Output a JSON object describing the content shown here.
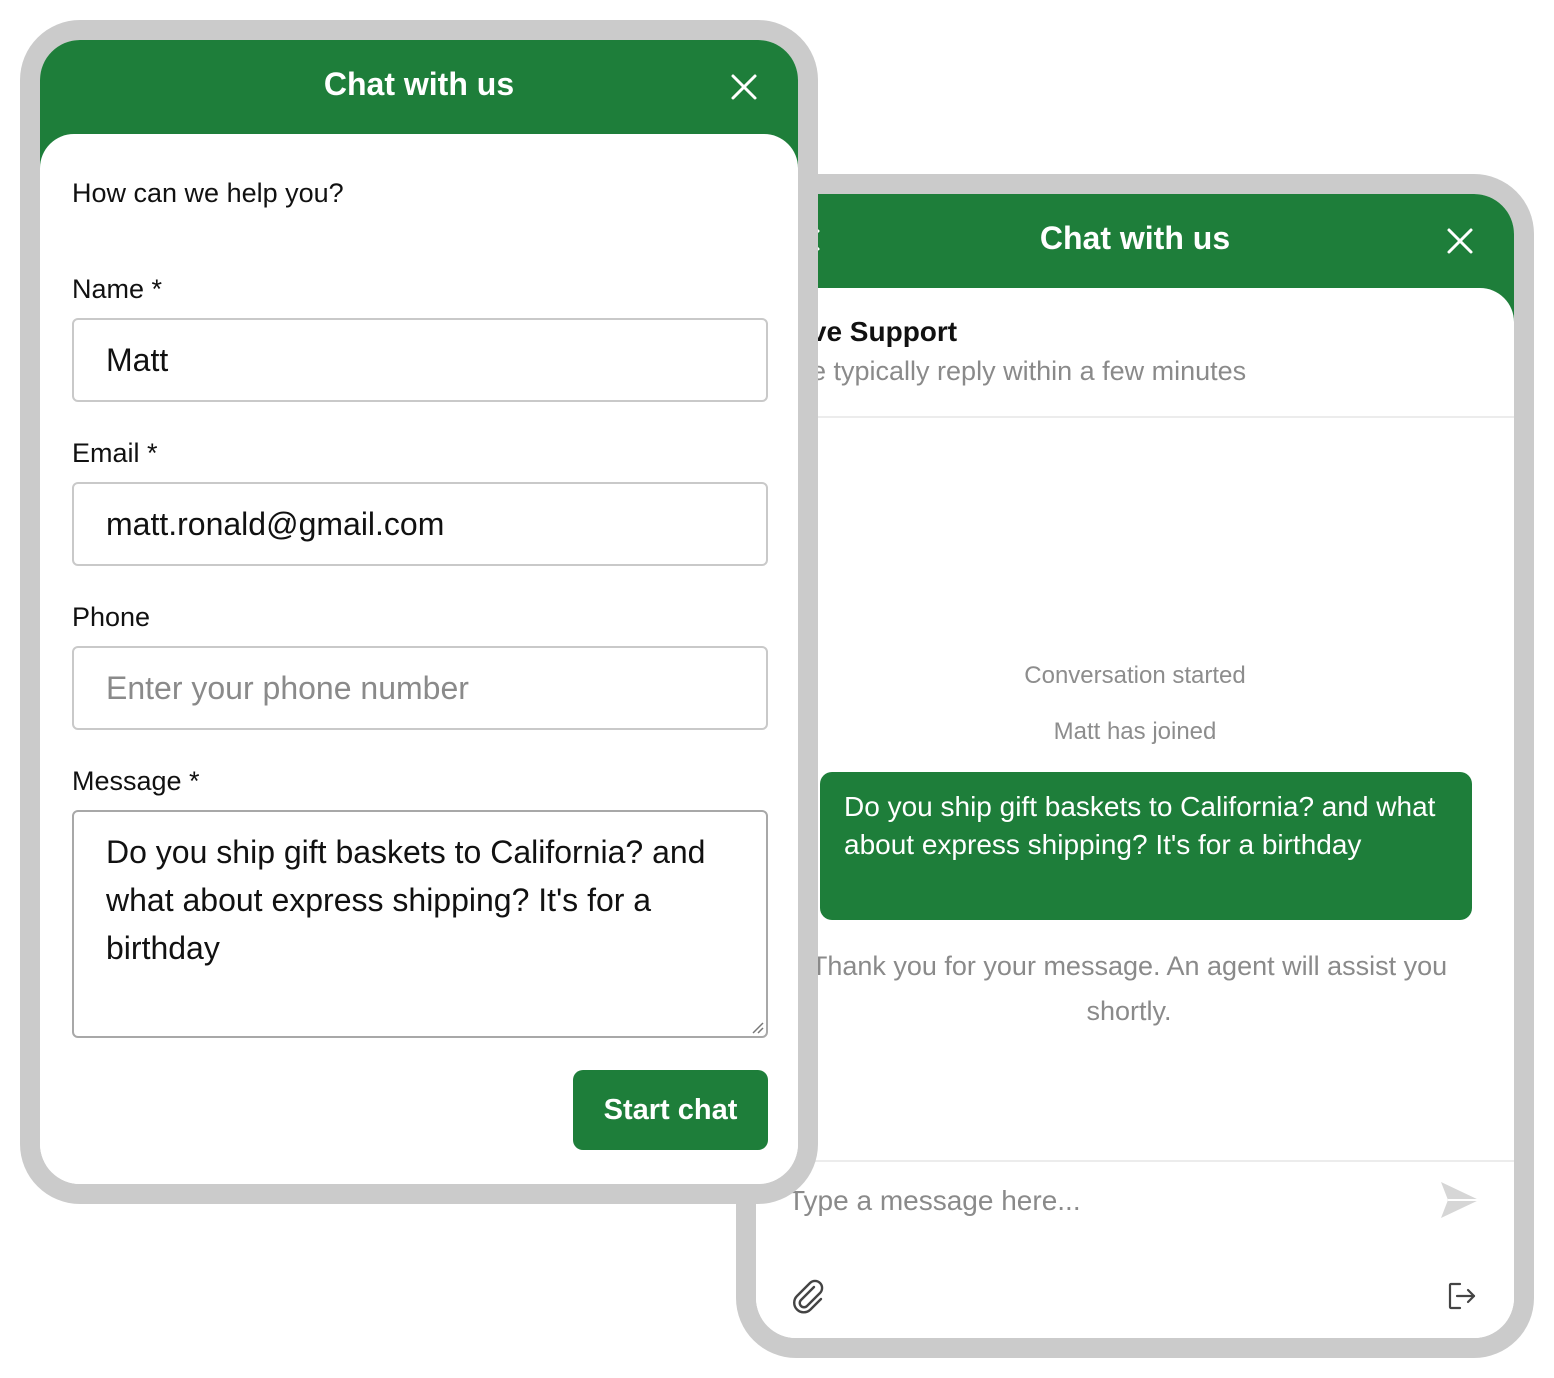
{
  "chat_form": {
    "title": "Chat with us",
    "intro": "How can we help you?",
    "name": {
      "label": "Name *",
      "value": "Matt"
    },
    "email": {
      "label": "Email *",
      "value": "matt.ronald@gmail.com"
    },
    "phone": {
      "label": "Phone",
      "value": "",
      "placeholder": "Enter your phone number"
    },
    "message": {
      "label": "Message *",
      "value": "Do you ship gift baskets to California? and what about express shipping? It's for a birthday"
    },
    "start_button": "Start chat",
    "icons": {
      "close": "close-icon"
    }
  },
  "conversation": {
    "title": "Chat with us",
    "agent_name": "Live Support",
    "agent_subtitle": "We typically reply within a few minutes",
    "system_messages": [
      "Conversation started",
      "Matt has joined"
    ],
    "user_message": "Do you ship gift baskets to California? and what about express shipping? It's for a birthday",
    "auto_reply": "Thank you for your message. An agent will assist you shortly.",
    "input_placeholder": "Type a message here...",
    "icons": {
      "back": "chevron-left-icon",
      "close": "close-icon",
      "send": "send-icon",
      "attach": "paperclip-icon",
      "exit": "exit-icon"
    }
  },
  "colors": {
    "brand_green": "#1e7e3a",
    "frame_gray": "#cbcbcb",
    "muted_text": "#8a8a8a"
  }
}
